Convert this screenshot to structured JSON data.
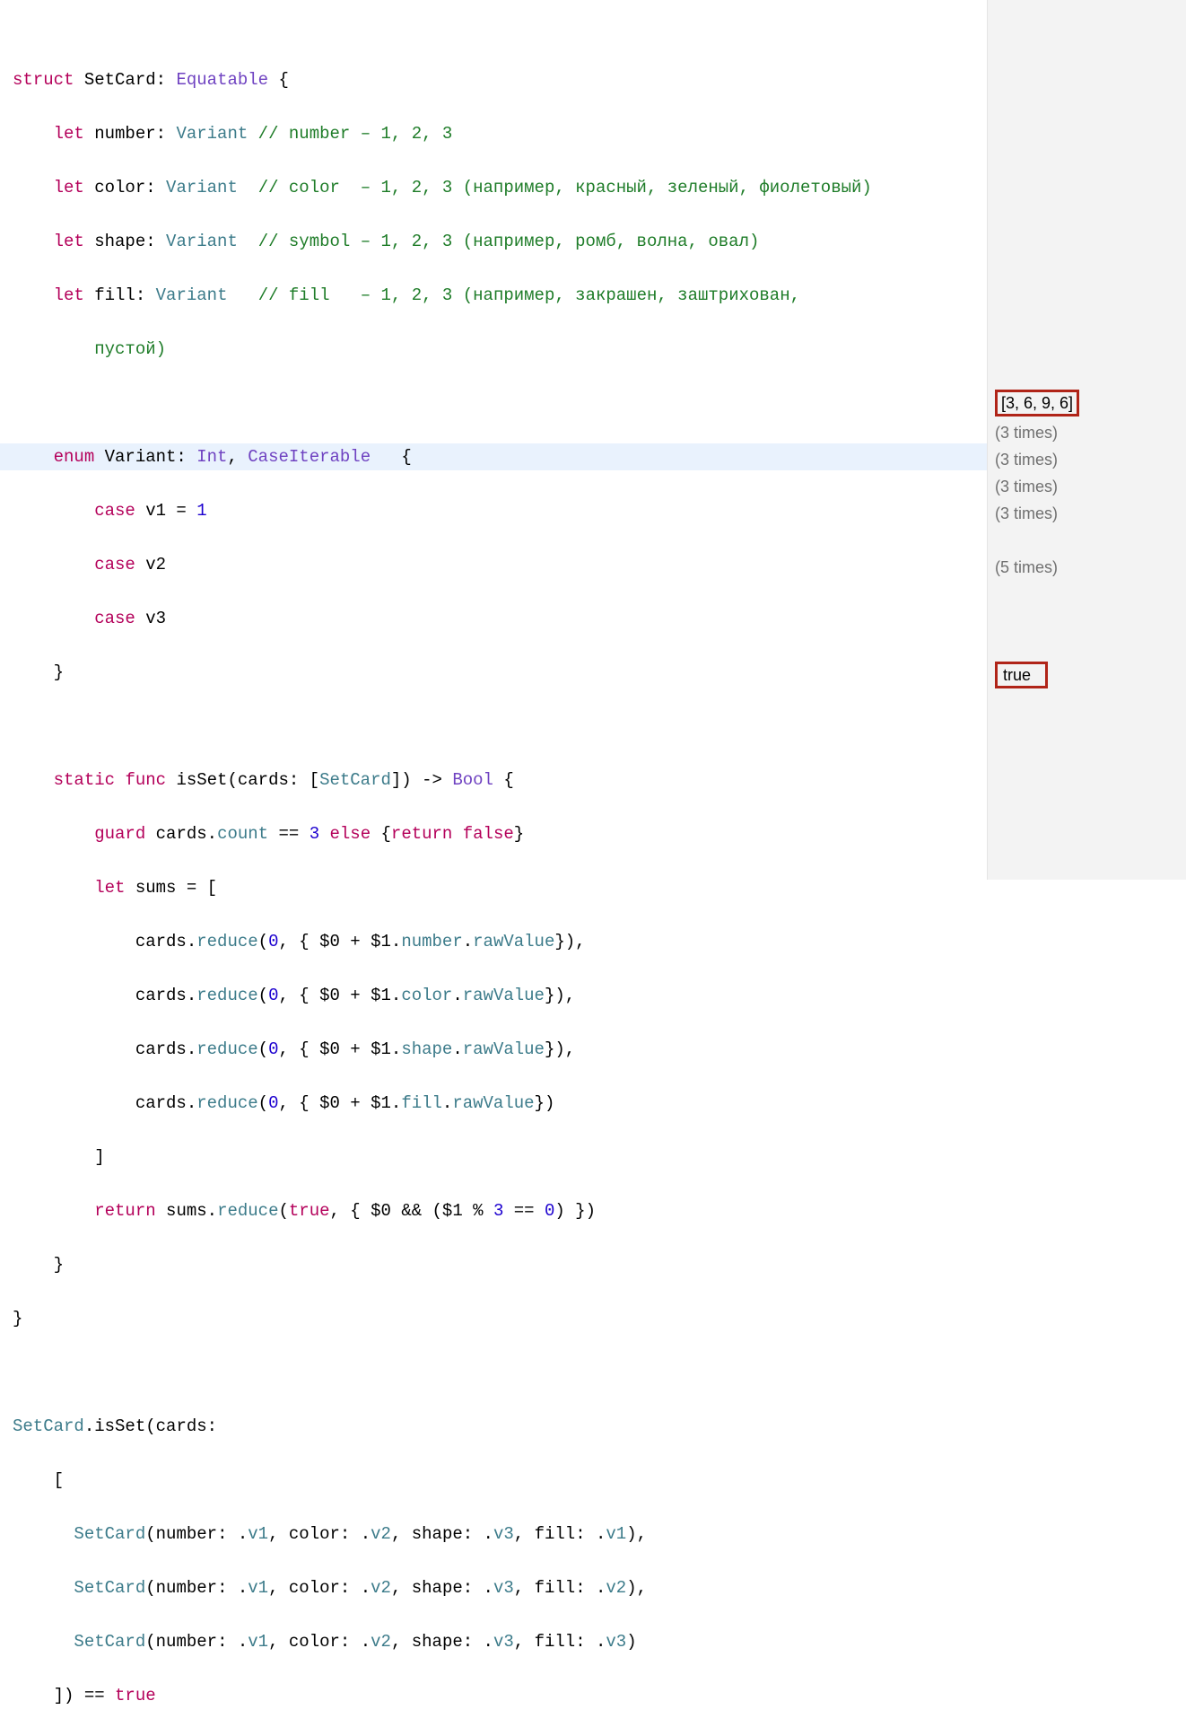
{
  "code": {
    "l1_struct": "struct",
    "l1_name": "SetCard",
    "l1_colon": ": ",
    "l1_proto": "Equatable",
    "l1_open": " {",
    "l2_indent": "    ",
    "l2_let": "let",
    "l2_name": " number: ",
    "l2_type": "Variant",
    "l2_comment": " // number – 1, 2, 3",
    "l3_indent": "    ",
    "l3_let": "let",
    "l3_name": " color: ",
    "l3_type": "Variant",
    "l3_pad": "  ",
    "l3_comment": "// color  – 1, 2, 3 (например, красный, зеленый, фиолетовый)",
    "l4_indent": "    ",
    "l4_let": "let",
    "l4_name": " shape: ",
    "l4_type": "Variant",
    "l4_pad": "  ",
    "l4_comment": "// symbol – 1, 2, 3 (например, ромб, волна, овал)",
    "l5_indent": "    ",
    "l5_let": "let",
    "l5_name": " fill: ",
    "l5_type": "Variant",
    "l5_pad": "   ",
    "l5_comment": "// fill   – 1, 2, 3 (например, закрашен, заштрихован,",
    "l5b_indent": "        ",
    "l5b_comment": "пустой)",
    "l7_indent": "    ",
    "l7_enum": "enum",
    "l7_name": " Variant: ",
    "l7_int": "Int",
    "l7_sep": ", ",
    "l7_ci": "CaseIterable",
    "l7_open": "   {",
    "l8_indent": "        ",
    "l8_case": "case",
    "l8_name": " v1 = ",
    "l8_num": "1",
    "l9_indent": "        ",
    "l9_case": "case",
    "l9_name": " v2",
    "l10_indent": "        ",
    "l10_case": "case",
    "l10_name": " v3",
    "l11_indent": "    ",
    "l11_close": "}",
    "l13_indent": "    ",
    "l13_static": "static",
    "l13_sp": " ",
    "l13_func": "func",
    "l13_name": " isSet(cards: [",
    "l13_type": "SetCard",
    "l13_rest": "]) -> ",
    "l13_bool": "Bool",
    "l13_open": " {",
    "l14_indent": "        ",
    "l14_guard": "guard",
    "l14_mid1": " cards.",
    "l14_count": "count",
    "l14_mid2": " == ",
    "l14_num": "3",
    "l14_sp": " ",
    "l14_else": "else",
    "l14_mid3": " {",
    "l14_return": "return",
    "l14_sp2": " ",
    "l14_false": "false",
    "l14_close": "}",
    "l15_indent": "        ",
    "l15_let": "let",
    "l15_rest": " sums = [",
    "l16_indent": "            ",
    "l16_a": "cards.",
    "l16_reduce": "reduce",
    "l16_b": "(",
    "l16_zero": "0",
    "l16_c": ", { $0 + $1.",
    "l16_prop": "number",
    "l16_d": ".",
    "l16_raw": "rawValue",
    "l16_e": "}),",
    "l17_indent": "            ",
    "l17_a": "cards.",
    "l17_reduce": "reduce",
    "l17_b": "(",
    "l17_zero": "0",
    "l17_c": ", { $0 + $1.",
    "l17_prop": "color",
    "l17_d": ".",
    "l17_raw": "rawValue",
    "l17_e": "}),",
    "l18_indent": "            ",
    "l18_a": "cards.",
    "l18_reduce": "reduce",
    "l18_b": "(",
    "l18_zero": "0",
    "l18_c": ", { $0 + $1.",
    "l18_prop": "shape",
    "l18_d": ".",
    "l18_raw": "rawValue",
    "l18_e": "}),",
    "l19_indent": "            ",
    "l19_a": "cards.",
    "l19_reduce": "reduce",
    "l19_b": "(",
    "l19_zero": "0",
    "l19_c": ", { $0 + $1.",
    "l19_prop": "fill",
    "l19_d": ".",
    "l19_raw": "rawValue",
    "l19_e": "})",
    "l20_indent": "        ",
    "l20_close": "]",
    "l21_indent": "        ",
    "l21_return": "return",
    "l21_a": " sums.",
    "l21_reduce": "reduce",
    "l21_b": "(",
    "l21_true": "true",
    "l21_c": ", { $0 && ($1 % ",
    "l21_three": "3",
    "l21_d": " == ",
    "l21_zero": "0",
    "l21_e": ") })",
    "l22_indent": "    ",
    "l22_close": "}",
    "l23_close": "}",
    "l25_a": "SetCard",
    "l25_b": ".isSet(cards:",
    "l26_indent": "    ",
    "l26_open": "[",
    "l27_indent": "      ",
    "l27_type": "SetCard",
    "l27_a": "(number: .",
    "l27_v1": "v1",
    "l27_b": ", color: .",
    "l27_v2": "v2",
    "l27_c": ", shape: .",
    "l27_v3": "v3",
    "l27_d": ", fill: .",
    "l27_v4": "v1",
    "l27_e": "),",
    "l28_indent": "      ",
    "l28_type": "SetCard",
    "l28_a": "(number: .",
    "l28_v1": "v1",
    "l28_b": ", color: .",
    "l28_v2": "v2",
    "l28_c": ", shape: .",
    "l28_v3": "v3",
    "l28_d": ", fill: .",
    "l28_v4": "v2",
    "l28_e": "),",
    "l29_indent": "      ",
    "l29_type": "SetCard",
    "l29_a": "(number: .",
    "l29_v1": "v1",
    "l29_b": ", color: .",
    "l29_v2": "v2",
    "l29_c": ", shape: .",
    "l29_v3": "v3",
    "l29_d": ", fill: .",
    "l29_v4": "v3",
    "l29_e": ")",
    "l30_indent": "    ",
    "l30_a": "]) == ",
    "l30_true": "true"
  },
  "sidebar": {
    "r15": "[3, 6, 9, 6]",
    "r16": "(3 times)",
    "r17": "(3 times)",
    "r18": "(3 times)",
    "r19": "(3 times)",
    "r21": "(5 times)",
    "r25": "true"
  }
}
